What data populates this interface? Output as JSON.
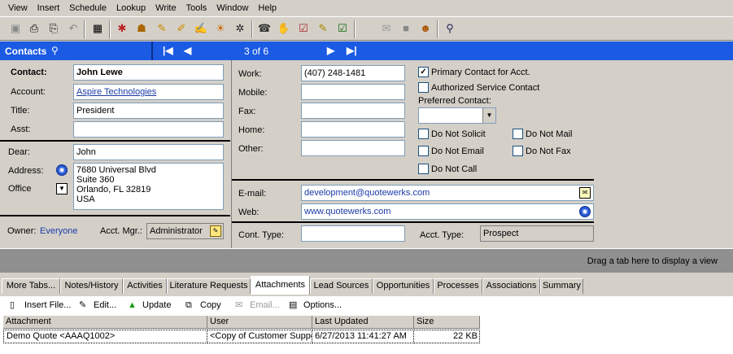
{
  "menu": [
    "View",
    "Insert",
    "Schedule",
    "Lookup",
    "Write",
    "Tools",
    "Window",
    "Help"
  ],
  "toolbar_icons": [
    "save-icon",
    "print-icon",
    "print-preview-icon",
    "undo-icon",
    "table-view-icon",
    "new-contact-icon",
    "new-group-icon",
    "new-activity-icon",
    "new-note-icon",
    "write-letter-icon",
    "lookup-icon",
    "debug-icon",
    "phone-icon",
    "handshake-icon",
    "task-list-icon",
    "notepad-icon",
    "checkbox-icon",
    "email-disabled-icon",
    "stop-icon",
    "people-icon",
    "search-icon"
  ],
  "header": {
    "title": "Contacts",
    "record_counter": "3 of 6",
    "accent_color": "#1b5ae2"
  },
  "contact": {
    "labels": {
      "contact": "Contact:",
      "account": "Account:",
      "title": "Title:",
      "asst": "Asst:",
      "dear": "Dear:",
      "address": "Address:",
      "office": "Office",
      "owner": "Owner:",
      "acct_mgr": "Acct. Mgr.:"
    },
    "name": "John Lewe",
    "account": "Aspire Technologies",
    "title": "President",
    "asst": "",
    "dear": "John",
    "address": [
      "7680 Universal Blvd",
      "Suite 360",
      "Orlando, FL 32819",
      "USA"
    ],
    "owner": "Everyone",
    "acct_mgr": "Administrator"
  },
  "phones": {
    "labels": {
      "work": "Work:",
      "mobile": "Mobile:",
      "fax": "Fax:",
      "home": "Home:",
      "other": "Other:",
      "email": "E-mail:",
      "web": "Web:",
      "cont_type": "Cont. Type:",
      "acct_type": "Acct. Type:"
    },
    "work": "(407) 248-1481",
    "mobile": "",
    "fax": "",
    "home": "",
    "other": "",
    "email": "development@quotewerks.com",
    "web": "www.quotewerks.com",
    "cont_type": "",
    "acct_type": "Prospect"
  },
  "flags": {
    "primary_contact": "Primary Contact for Acct.",
    "authorized_service": "Authorized Service Contact",
    "preferred_contact_label": "Preferred Contact:",
    "preferred_contact_value": "",
    "do_not_solicit": "Do Not Solicit",
    "do_not_mail": "Do Not Mail",
    "do_not_email": "Do Not Email",
    "do_not_fax": "Do Not Fax",
    "do_not_call": "Do Not Call"
  },
  "drag_hint": "Drag a tab here to display a view",
  "tabs": [
    "More Tabs...",
    "Notes/History",
    "Activities",
    "Literature Requests",
    "Attachments",
    "Lead Sources",
    "Opportunities",
    "Processes",
    "Associations",
    "Summary"
  ],
  "active_tab": "Attachments",
  "actions": {
    "insert": "Insert File...",
    "edit": "Edit...",
    "update": "Update",
    "copy": "Copy",
    "email": "Email...",
    "options": "Options..."
  },
  "grid": {
    "columns": [
      "Attachment",
      "User",
      "Last Updated",
      "Size"
    ],
    "rows": [
      [
        "Demo Quote <AAAQ1002>",
        "<Copy of Customer Support",
        "6/27/2013 11:41:27 AM",
        "22 KB"
      ]
    ]
  }
}
